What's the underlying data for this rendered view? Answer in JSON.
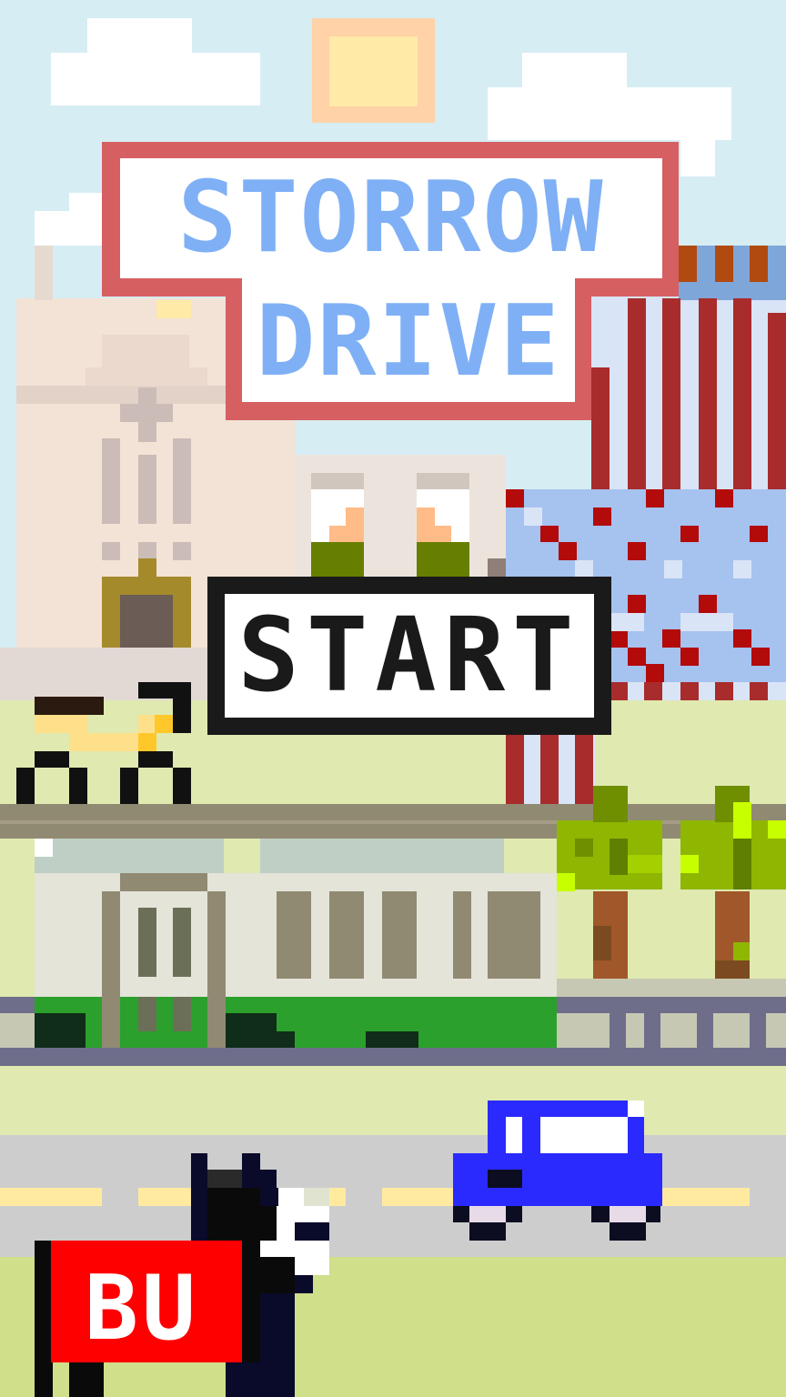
{
  "title": {
    "line1": "STORROW",
    "line2": "DRIVE"
  },
  "start_button": {
    "label": "START"
  },
  "mascot": {
    "banner_text": "BU"
  },
  "colors": {
    "sky": "#d6edf3",
    "sign_border": "#d65f62",
    "title_text": "#7fb0f5",
    "sun": "#ffeaa8",
    "grass": "#dfe9b0",
    "road": "#cdcdcd",
    "road_line": "#ffeaa0",
    "car": "#2a2aff",
    "bu_banner": "#ff0000"
  }
}
